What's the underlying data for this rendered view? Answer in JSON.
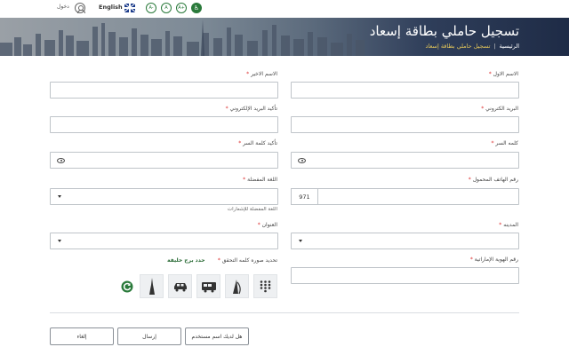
{
  "topbar": {
    "login_label": "دخول",
    "language_label": "English",
    "font_sizes": [
      "A-",
      "A",
      "A+"
    ],
    "icons": [
      "user-icon",
      "uk-flag-icon",
      "accessibility-icon"
    ]
  },
  "banner": {
    "title": "تسجيل حاملي بطاقة إسعاد",
    "breadcrumb_home": "الرئيسية",
    "breadcrumb_separator": "|",
    "breadcrumb_current": "تسجيل حاملي بطاقة إسعاد",
    "accent_color": "#e0c45a"
  },
  "form": {
    "first_name_label": "الاسم الاول",
    "last_name_label": "الاسم الاخير",
    "email_label": "البريد الكتروني",
    "confirm_email_label": "تأكيد البريد الإلكتروني",
    "password_label": "كلمه السر",
    "confirm_password_label": "تأكيد كلمة السر",
    "mobile_label": "رقم الهاتف المحمول",
    "mobile_code": "971",
    "language_label": "اللغة المفضلة",
    "language_hint": "اللغة المفضلة للإشعارات",
    "city_label": "المدينه",
    "address_label": "العنوان",
    "emirates_id_label": "رقم الهوية الإماراتية",
    "captcha_label": "تحديد صوره كلمه التحقق",
    "captcha_hint": "حدد برج خليفة",
    "required_mark": "*",
    "captcha_tiles": [
      "dial-pad-icon",
      "burj-al-arab-icon",
      "bus-icon",
      "car-icon",
      "burj-khalifa-icon",
      "refresh-captcha-icon"
    ]
  },
  "buttons": {
    "existing_user": "هل لديك اسم مستخدم",
    "submit": "إرسال",
    "cancel": "إلغاء"
  }
}
